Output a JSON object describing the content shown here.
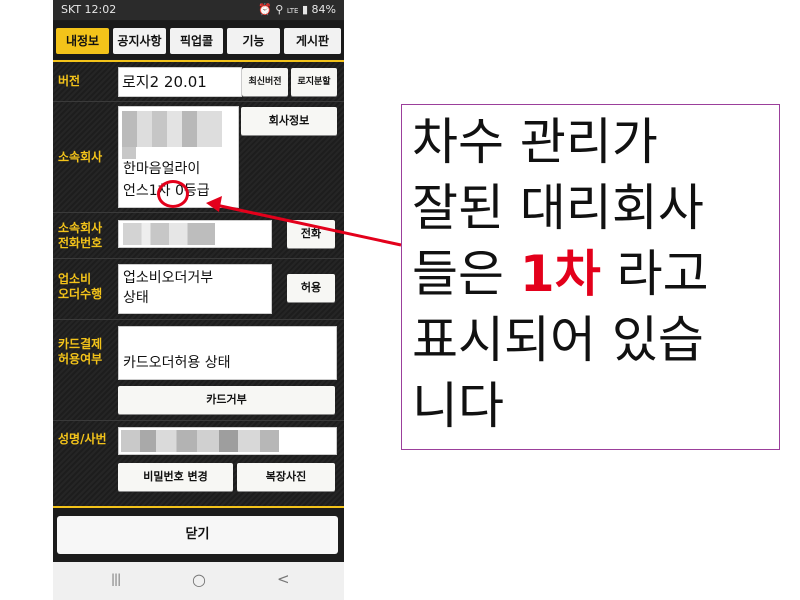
{
  "status_bar": {
    "carrier_time": "SKT 12:02",
    "indicators": "LTE",
    "battery": "84%"
  },
  "tabs": [
    {
      "label": "내정보",
      "active": true
    },
    {
      "label": "공지사항",
      "active": false
    },
    {
      "label": "픽업콜",
      "active": false
    },
    {
      "label": "기능",
      "active": false
    },
    {
      "label": "게시판",
      "active": false
    }
  ],
  "version": {
    "label": "버전",
    "value": "로지2 20.01",
    "latest_button": "최신버전",
    "split_button": "로지분할"
  },
  "company": {
    "label": "소속회사",
    "line1": "한마음얼라이",
    "line2": "언스1차 0등급",
    "info_button": "회사정보"
  },
  "company_phone": {
    "label_line1": "소속회사",
    "label_line2": "전화번호",
    "call_button": "전화"
  },
  "fee": {
    "label_line1": "업소비",
    "label_line2": "오더수행",
    "value_line1": "업소비오더거부",
    "value_line2": "상태",
    "allow_button": "허용"
  },
  "card": {
    "label_line1": "카드결제",
    "label_line2": "허용여부",
    "value": "카드오더허용 상태",
    "reject_button": "카드거부"
  },
  "name": {
    "label": "성명/사번",
    "password_button": "비밀번호 변경",
    "photo_button": "복장사진"
  },
  "close_button": "닫기",
  "nav": {
    "recent": "|||",
    "home": "○",
    "back": "<"
  },
  "callout": {
    "line1": "차수 관리가",
    "line2": "잘된 대리회사",
    "line3_before": "들은 ",
    "line3_highlight": "1차",
    "line3_after": " 라고",
    "line4": "표시되어 있습",
    "line5": "니다"
  },
  "colors": {
    "accent": "#f3c31a",
    "highlight": "#e3001b",
    "callout_border": "#9b3f9b"
  }
}
